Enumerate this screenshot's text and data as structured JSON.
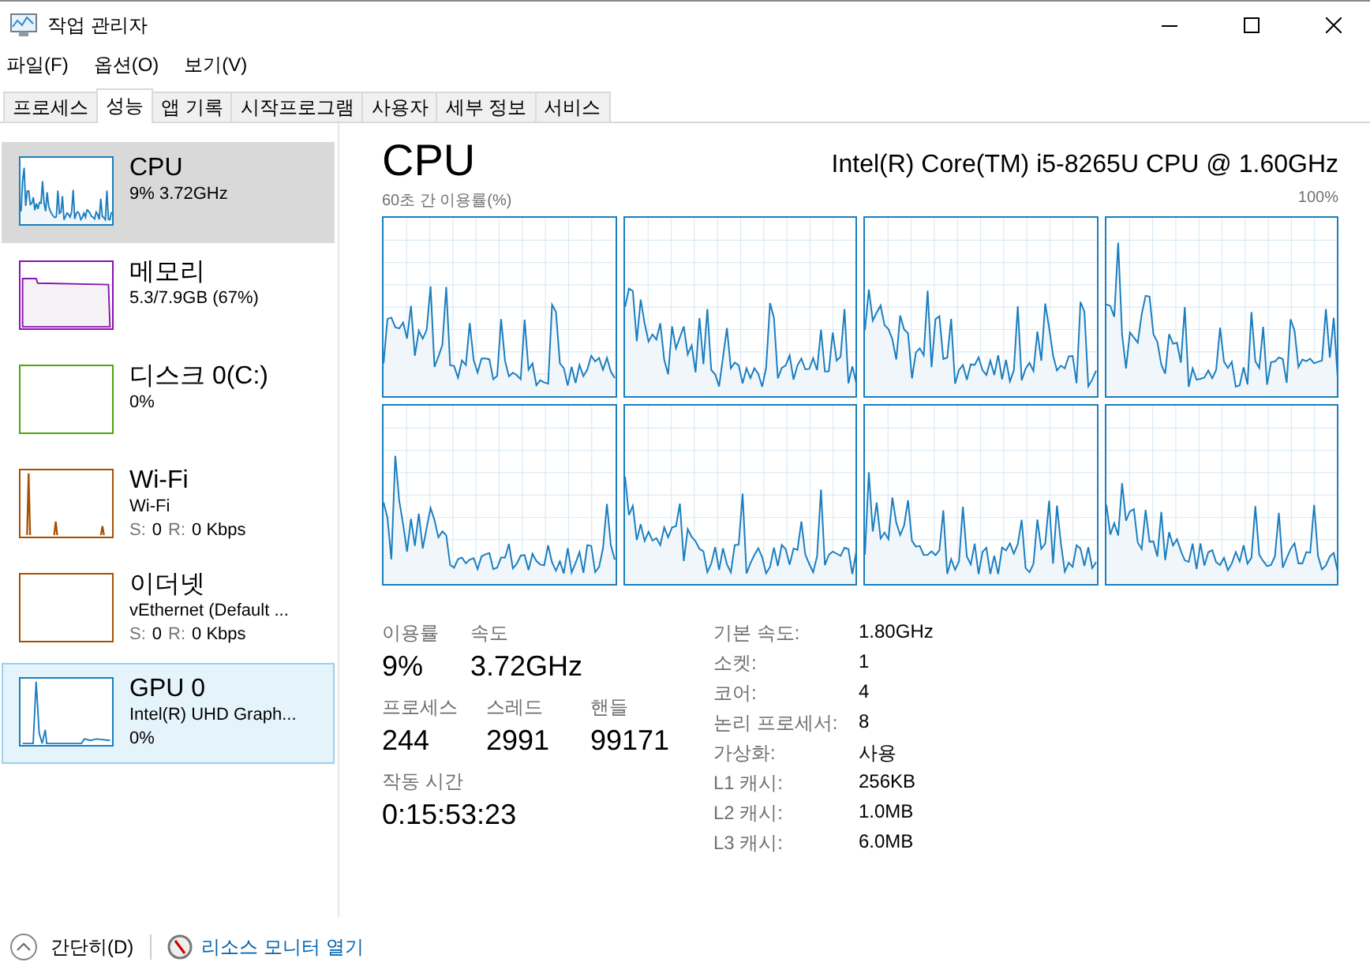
{
  "window": {
    "title": "작업 관리자"
  },
  "menu": [
    "파일(F)",
    "옵션(O)",
    "보기(V)"
  ],
  "tabs": [
    {
      "label": "프로세스",
      "selected": false
    },
    {
      "label": "성능",
      "selected": true
    },
    {
      "label": "앱 기록",
      "selected": false
    },
    {
      "label": "시작프로그램",
      "selected": false
    },
    {
      "label": "사용자",
      "selected": false
    },
    {
      "label": "세부 정보",
      "selected": false
    },
    {
      "label": "서비스",
      "selected": false
    }
  ],
  "sidebar": {
    "items": [
      {
        "name": "CPU",
        "lines": [
          "9% 3.72GHz"
        ],
        "color": "#1a7ec0",
        "selected": true,
        "hovered": false
      },
      {
        "name": "메모리",
        "lines": [
          "5.3/7.9GB (67%)"
        ],
        "color": "#8b12ae",
        "selected": false,
        "hovered": false
      },
      {
        "name": "디스크 0(C:)",
        "lines": [
          "0%"
        ],
        "color": "#4da60c",
        "selected": false,
        "hovered": false
      },
      {
        "name": "Wi-Fi",
        "lines": [
          "Wi-Fi"
        ],
        "rates": [
          {
            "label": "S:",
            "value": "0"
          },
          {
            "label": "R:",
            "value": "0 Kbps"
          }
        ],
        "color": "#a74f01",
        "selected": false,
        "hovered": false
      },
      {
        "name": "이더넷",
        "lines": [
          "vEthernet (Default ..."
        ],
        "rates": [
          {
            "label": "S:",
            "value": "0"
          },
          {
            "label": "R:",
            "value": "0 Kbps"
          }
        ],
        "color": "#a74f01",
        "selected": false,
        "hovered": false
      },
      {
        "name": "GPU 0",
        "lines": [
          "Intel(R) UHD Graph...",
          "0%"
        ],
        "color": "#1a7ec0",
        "selected": false,
        "hovered": true
      }
    ]
  },
  "main": {
    "title": "CPU",
    "processor": "Intel(R) Core(TM) i5-8265U CPU @ 1.60GHz",
    "graph_caption": "60초 간 이용률(%)",
    "graph_max": "100%",
    "stats": [
      [
        {
          "label": "이용률",
          "value": "9%"
        },
        {
          "label": "속도",
          "value": "3.72GHz"
        }
      ],
      [
        {
          "label": "프로세스",
          "value": "244"
        },
        {
          "label": "스레드",
          "value": "2991"
        },
        {
          "label": "핸들",
          "value": "99171"
        }
      ],
      [
        {
          "label": "작동 시간",
          "value": "0:15:53:23"
        }
      ]
    ],
    "details": [
      {
        "label": "기본 속도:",
        "value": "1.80GHz"
      },
      {
        "label": "소켓:",
        "value": "1"
      },
      {
        "label": "코어:",
        "value": "4"
      },
      {
        "label": "논리 프로세서:",
        "value": "8"
      },
      {
        "label": "가상화:",
        "value": "사용"
      },
      {
        "label": "L1 캐시:",
        "value": "256KB"
      },
      {
        "label": "L2 캐시:",
        "value": "1.0MB"
      },
      {
        "label": "L3 캐시:",
        "value": "6.0MB"
      }
    ]
  },
  "footer": {
    "fewer_details": "간단히(D)",
    "resource_monitor": "리소스 모니터 열기"
  }
}
